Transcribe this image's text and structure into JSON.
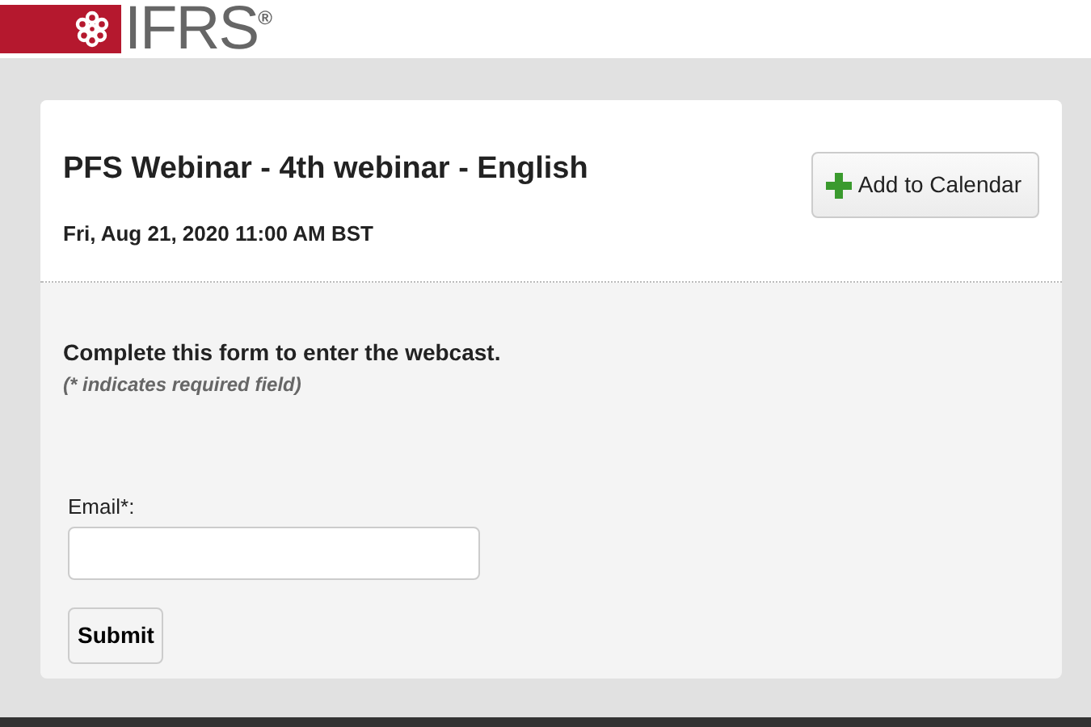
{
  "logo": {
    "text": "IFRS",
    "mark": "®"
  },
  "event": {
    "title": "PFS Webinar - 4th webinar - English",
    "datetime": "Fri, Aug 21, 2020 11:00 AM BST",
    "calendar_button": "Add to Calendar"
  },
  "form": {
    "heading": "Complete this form to enter the webcast.",
    "note": "(* indicates required field)",
    "fields": [
      {
        "label": "Email*:",
        "kind": "text"
      }
    ],
    "submit": "Submit"
  }
}
